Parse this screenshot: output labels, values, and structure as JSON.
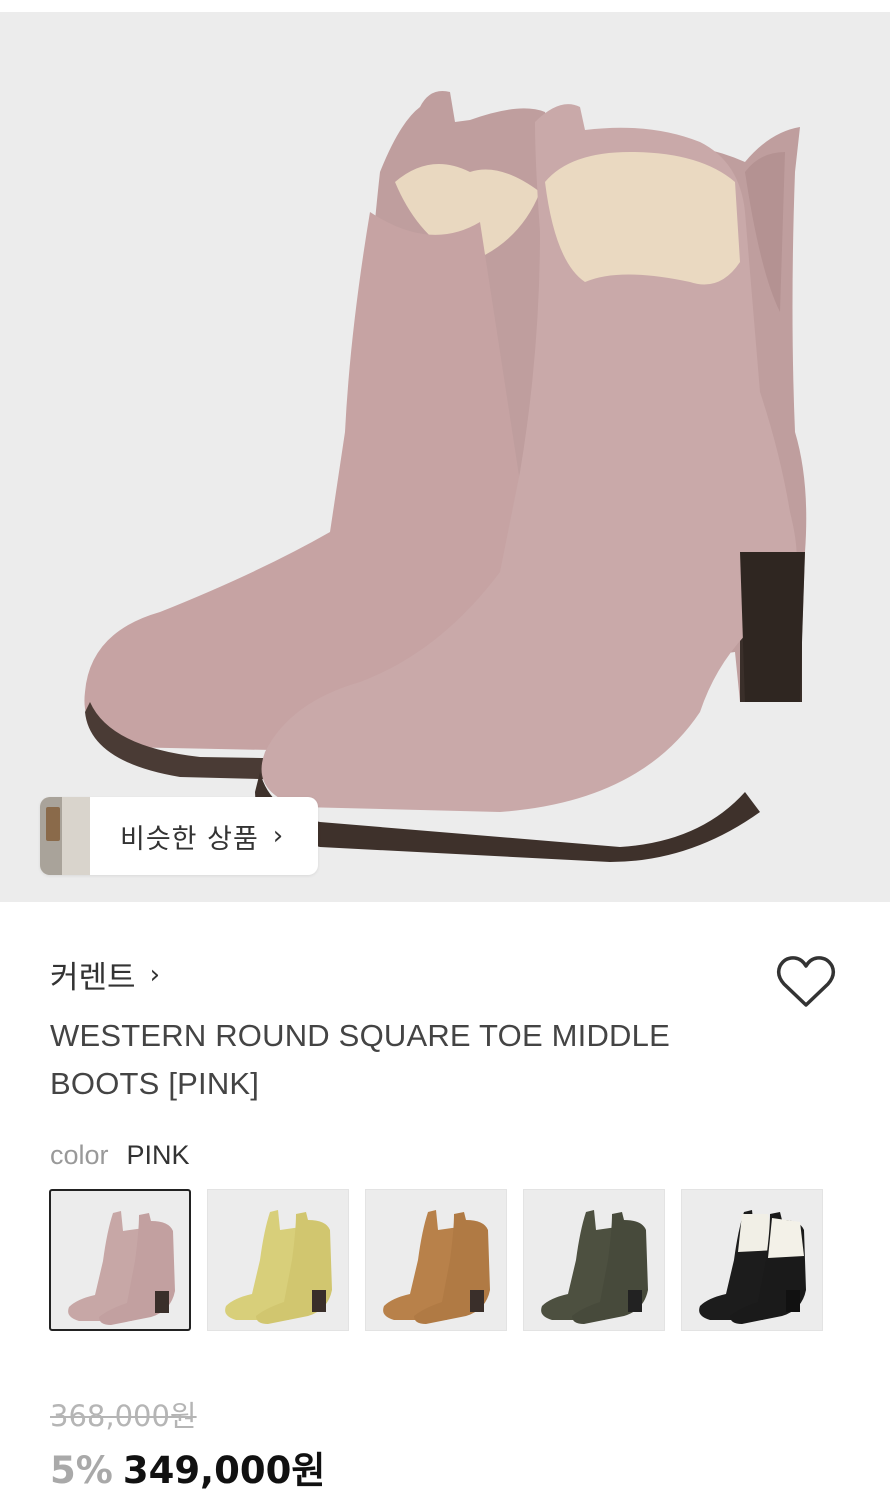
{
  "hero": {
    "image_icon": "product-photo-pink-boots",
    "boot_color": "#c8a8a8"
  },
  "similar_products": {
    "label": "비슷한 상품",
    "chevron": "›"
  },
  "brand": {
    "name": "커렌트",
    "chevron": "›"
  },
  "wishlist": {
    "icon": "heart-outline-icon"
  },
  "product": {
    "title": "WESTERN ROUND SQUARE TOE MIDDLE BOOTS [PINK]"
  },
  "color_option": {
    "key": "color",
    "value": "PINK"
  },
  "swatches": [
    {
      "name": "pink",
      "color": "#c7a7a6",
      "selected": true
    },
    {
      "name": "yellow",
      "color": "#d8cf7a",
      "selected": false
    },
    {
      "name": "camel",
      "color": "#b8814a",
      "selected": false
    },
    {
      "name": "khaki",
      "color": "#4d5040",
      "selected": false
    },
    {
      "name": "black-white",
      "color": "#1c1c1c",
      "selected": false
    }
  ],
  "pricing": {
    "original": "368,000원",
    "discount": "5%",
    "sale": "349,000원"
  }
}
